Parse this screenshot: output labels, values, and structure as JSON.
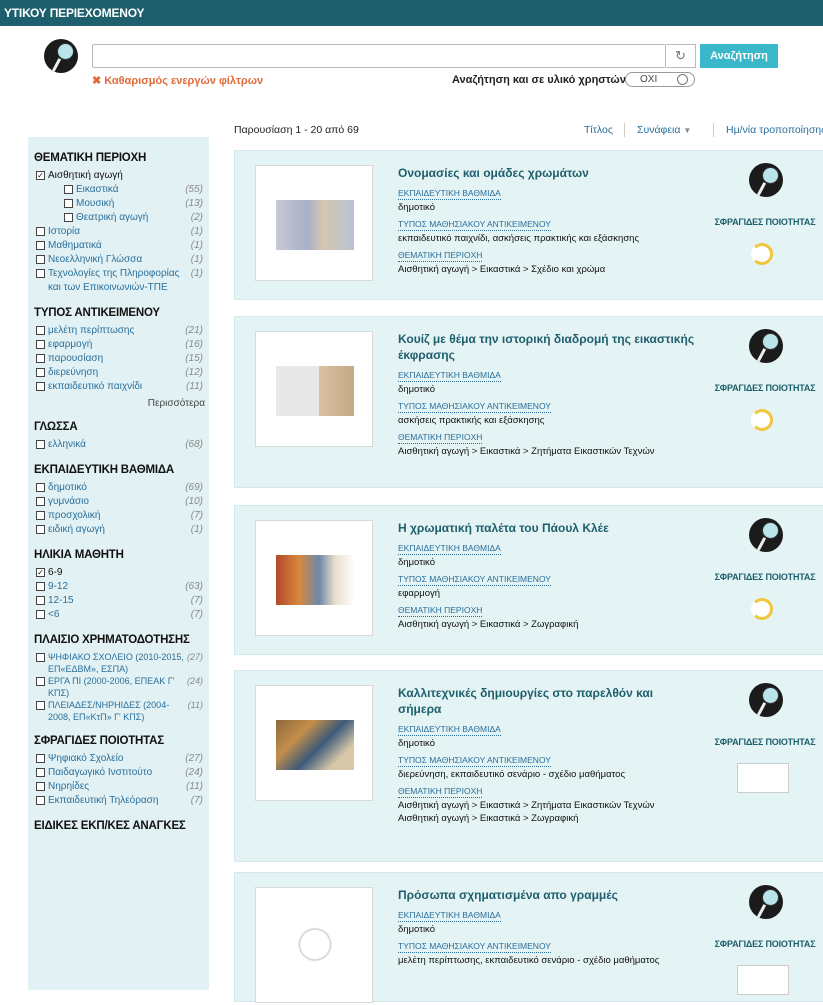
{
  "header": {
    "title": "ΥΤΙΚΟΥ ΠΕΡΙΕΧΟΜΕΝΟΥ"
  },
  "search": {
    "placeholder": "",
    "button_label": "Αναζήτηση",
    "clear_filters_label": "Καθαρισμός ενεργών φίλτρων",
    "user_material_label": "Αναζήτηση και σε υλικό χρηστών",
    "user_material_toggle": "ΟΧΙ"
  },
  "results": {
    "count_label": "Παρουσίαση 1 - 20 από 69",
    "sort_title": "Τίτλος",
    "sort_relevance": "Συνάφεια",
    "sort_modified": "Ημ/νία τροποποίησης"
  },
  "facets": {
    "thematic": {
      "title": "ΘΕΜΑΤΙΚΗ ΠΕΡΙΟΧΗ",
      "items": [
        {
          "label": "Αισθητική αγωγή",
          "count": "",
          "checked": true,
          "sub": false
        },
        {
          "label": "Εικαστικά",
          "count": "(55)",
          "checked": false,
          "sub": true
        },
        {
          "label": "Μουσική",
          "count": "(13)",
          "checked": false,
          "sub": true
        },
        {
          "label": "Θεατρική αγωγή",
          "count": "(2)",
          "checked": false,
          "sub": true
        },
        {
          "label": "Ιστορία",
          "count": "(1)",
          "checked": false,
          "sub": false
        },
        {
          "label": "Μαθηματικά",
          "count": "(1)",
          "checked": false,
          "sub": false
        },
        {
          "label": "Νεοελληνική Γλώσσα",
          "count": "(1)",
          "checked": false,
          "sub": false
        },
        {
          "label": "Τεχνολογίες της Πληροφορίας και των Επικοινωνιών-ΤΠΕ",
          "count": "(1)",
          "checked": false,
          "sub": false
        }
      ]
    },
    "object_type": {
      "title": "ΤΥΠΟΣ ΑΝΤΙΚΕΙΜΕΝΟΥ",
      "items": [
        {
          "label": "μελέτη περίπτωσης",
          "count": "(21)"
        },
        {
          "label": "εφαρμογή",
          "count": "(16)"
        },
        {
          "label": "παρουσίαση",
          "count": "(15)"
        },
        {
          "label": "διερεύνηση",
          "count": "(12)"
        },
        {
          "label": "εκπαιδευτικό παιχνίδι",
          "count": "(11)"
        }
      ],
      "more_label": "Περισσότερα"
    },
    "language": {
      "title": "ΓΛΩΣΣΑ",
      "items": [
        {
          "label": "ελληνικά",
          "count": "(68)"
        }
      ]
    },
    "level": {
      "title": "ΕΚΠΑΙΔΕΥΤΙΚΗ ΒΑΘΜΙΔΑ",
      "items": [
        {
          "label": "δημοτικό",
          "count": "(69)"
        },
        {
          "label": "γυμνάσιο",
          "count": "(10)"
        },
        {
          "label": "προσχολική",
          "count": "(7)"
        },
        {
          "label": "ειδική αγωγή",
          "count": "(1)"
        }
      ]
    },
    "age": {
      "title": "ΗΛΙΚΙΑ ΜΑΘΗΤΗ",
      "items": [
        {
          "label": "6-9",
          "count": "",
          "checked": true
        },
        {
          "label": "9-12",
          "count": "(63)",
          "checked": false
        },
        {
          "label": "12-15",
          "count": "(7)",
          "checked": false
        },
        {
          "label": "<6",
          "count": "(7)",
          "checked": false
        }
      ]
    },
    "funding": {
      "title": "ΠΛΑΙΣΙΟ ΧΡΗΜΑΤΟΔΟΤΗΣΗΣ",
      "items": [
        {
          "label": "ΨΗΦΙΑΚΟ ΣΧΟΛΕΙΟ (2010-2015, ΕΠ«ΕΔΒΜ», ΕΣΠΑ)",
          "count": "(27)"
        },
        {
          "label": "ΕΡΓΑ ΠΙ (2000-2006, ΕΠΕΑΚ Γ' ΚΠΣ)",
          "count": "(24)"
        },
        {
          "label": "ΠΛΕΙΑΔΕΣ/ΝΗΡΗΙΔΕΣ (2004-2008, ΕΠ«ΚτΠ» Γ' ΚΠΣ)",
          "count": "(11)"
        }
      ]
    },
    "seals": {
      "title": "ΣΦΡΑΓΙΔΕΣ ΠΟΙΟΤΗΤΑΣ",
      "items": [
        {
          "label": "Ψηφιακό Σχολείο",
          "count": "(27)"
        },
        {
          "label": "Παιδαγωγικό Ινστιτούτο",
          "count": "(24)"
        },
        {
          "label": "Νηρηίδες",
          "count": "(11)"
        },
        {
          "label": "Εκπαιδευτική Τηλεόραση",
          "count": "(7)"
        }
      ]
    },
    "special": {
      "title": "ΕΙΔΙΚΕΣ ΕΚΠ/ΚΕΣ ΑΝΑΓΚΕΣ"
    }
  },
  "labels": {
    "level": "ΕΚΠΑΙΔΕΥΤΙΚΗ ΒΑΘΜΙΔΑ",
    "type": "ΤΥΠΟΣ ΜΑΘΗΣΙΑΚΟΥ ΑΝΤΙΚΕΙΜΕΝΟΥ",
    "thematic": "ΘΕΜΑΤΙΚΗ ΠΕΡΙΟΧΗ",
    "seals": "ΣΦΡΑΓΙΔΕΣ ΠΟΙΟΤΗΤΑΣ"
  },
  "cards": [
    {
      "title": "Ονομασίες και ομάδες χρωμάτων",
      "level": "δημοτικό",
      "type": "εκπαιδευτικό παιχνίδι, ασκήσεις πρακτικής και εξάσκησης",
      "thematic": [
        "Αισθητική αγωγή > Εικαστικά > Σχέδιο και χρώμα"
      ],
      "seal": "moon"
    },
    {
      "title": "Κουίζ με θέμα την ιστορική διαδρομή της εικαστικής έκφρασης",
      "level": "δημοτικό",
      "type": "ασκήσεις πρακτικής και εξάσκησης",
      "thematic": [
        "Αισθητική αγωγή > Εικαστικά > Ζητήματα Εικαστικών Τεχνών"
      ],
      "seal": "moon"
    },
    {
      "title": "Η χρωματική παλέτα του Πάουλ Κλέε",
      "level": "δημοτικό",
      "type": "εφαρμογή",
      "thematic": [
        "Αισθητική αγωγή > Εικαστικά > Ζωγραφική"
      ],
      "seal": "moon"
    },
    {
      "title": "Καλλιτεχνικές δημιουργίες στο παρελθόν και σήμερα",
      "level": "δημοτικό",
      "type": "διερεύνηση, εκπαιδευτικό σενάριο - σχέδιο μαθήματος",
      "thematic": [
        "Αισθητική αγωγή > Εικαστικά > Ζητήματα Εικαστικών Τεχνών",
        "Αισθητική αγωγή > Εικαστικά > Ζωγραφική"
      ],
      "seal": "box"
    },
    {
      "title": "Πρόσωπα σχηματισμένα απο γραμμές",
      "level": "δημοτικό",
      "type": "μελέτη περίπτωσης, εκπαιδευτικό σενάριο - σχέδιο μαθήματος",
      "thematic": [],
      "seal": "box"
    }
  ]
}
